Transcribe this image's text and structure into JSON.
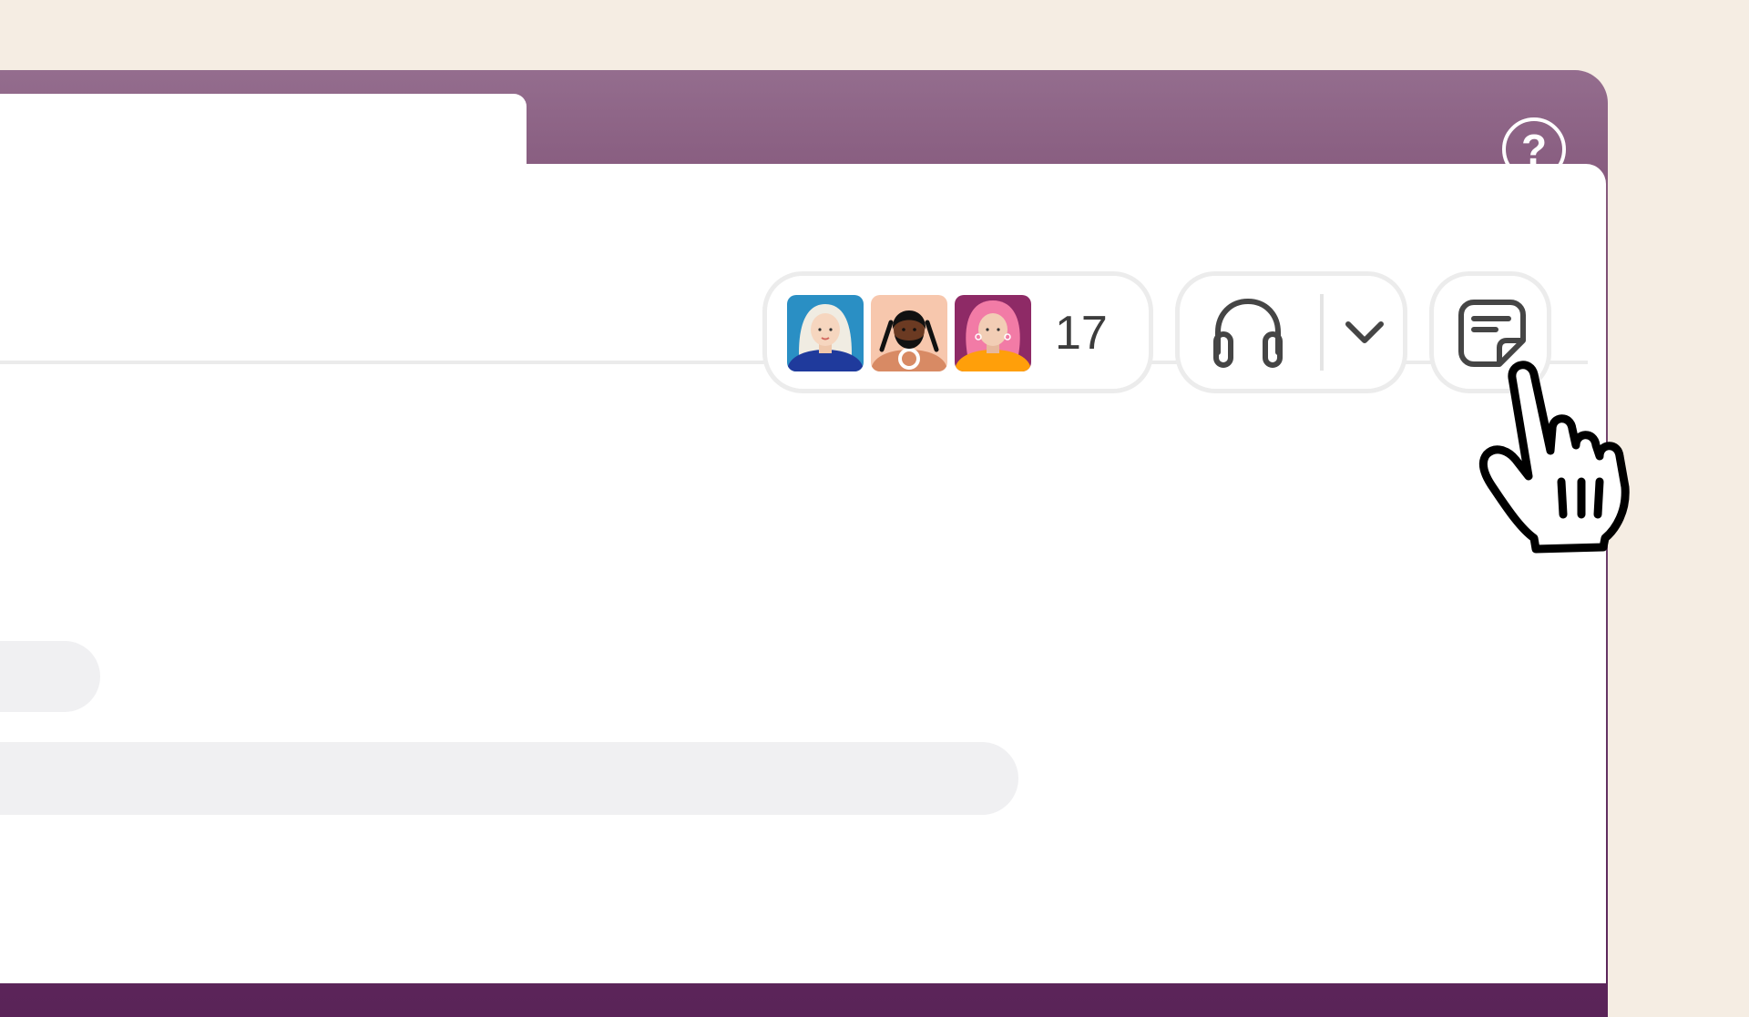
{
  "window": {
    "search": {
      "placeholder": ""
    },
    "help_icon": "question-circle-icon"
  },
  "header": {
    "members": {
      "avatars": [
        "avatar-white-hair",
        "avatar-braids-beard",
        "avatar-pink-hair"
      ],
      "count": "17"
    },
    "huddle": {
      "icon": "headphones-icon",
      "menu_icon": "chevron-down-icon"
    },
    "canvas": {
      "icon": "canvas-note-icon"
    }
  },
  "colors": {
    "background": "#f5ede3",
    "window_top": "#946d8e",
    "window_bottom": "#5a2358",
    "pill_border": "#ececec",
    "placeholder": "#f0f0f2"
  }
}
